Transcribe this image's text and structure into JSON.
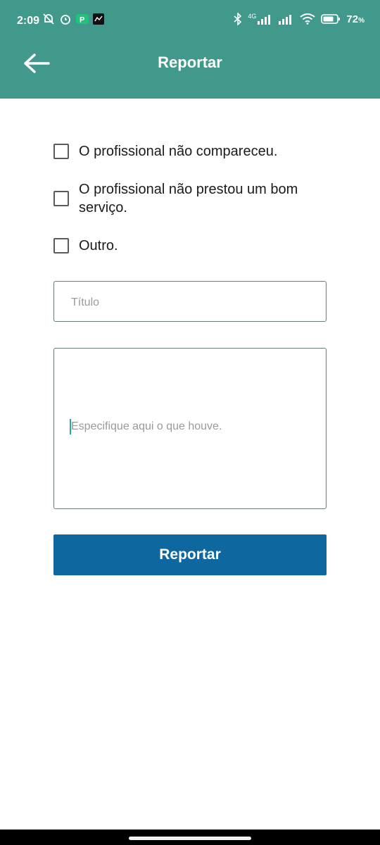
{
  "status_bar": {
    "time": "2:09",
    "battery": "72",
    "battery_unit": "%",
    "network": "4G"
  },
  "header": {
    "title": "Reportar"
  },
  "options": [
    {
      "label": "O profissional não compareceu.",
      "checked": false
    },
    {
      "label": "O profissional não prestou um bom serviço.",
      "checked": false
    },
    {
      "label": "Outro.",
      "checked": false
    }
  ],
  "form": {
    "title_placeholder": "Título",
    "description_placeholder": "Especifique aqui o que houve."
  },
  "submit_label": "Reportar",
  "colors": {
    "appbar": "#40998a",
    "button": "#0f67a0"
  },
  "icons": {
    "back": "arrow-left-icon",
    "checkbox": "checkbox-unchecked-icon"
  }
}
